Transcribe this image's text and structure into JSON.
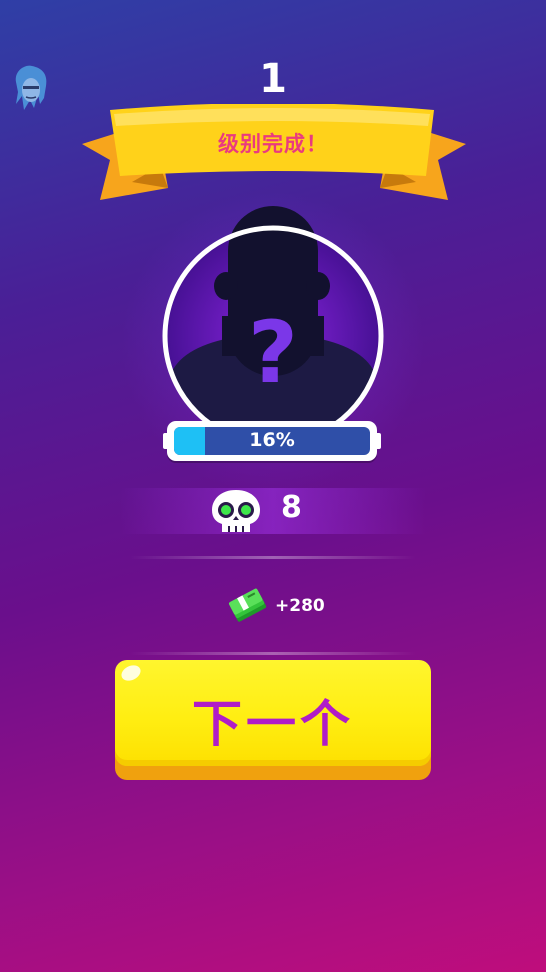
{
  "header": {
    "level_number": "1",
    "banner_text": "级别完成！"
  },
  "avatar": {
    "icon": "character-avatar-icon"
  },
  "portrait": {
    "icon": "mystery-silhouette-icon",
    "glyph": "?"
  },
  "progress": {
    "percent": 16,
    "label": "16%"
  },
  "kills": {
    "icon": "skull-icon",
    "count": "8"
  },
  "reward": {
    "icon": "cash-stack-icon",
    "amount": "+280"
  },
  "next_button": {
    "label": "下一个"
  },
  "colors": {
    "banner_text": "#ea3a7f",
    "button_text": "#b01cc8",
    "button_face": "#ffee12",
    "progress_fill": "#1ec0f5",
    "progress_track": "#2f4fa8"
  }
}
